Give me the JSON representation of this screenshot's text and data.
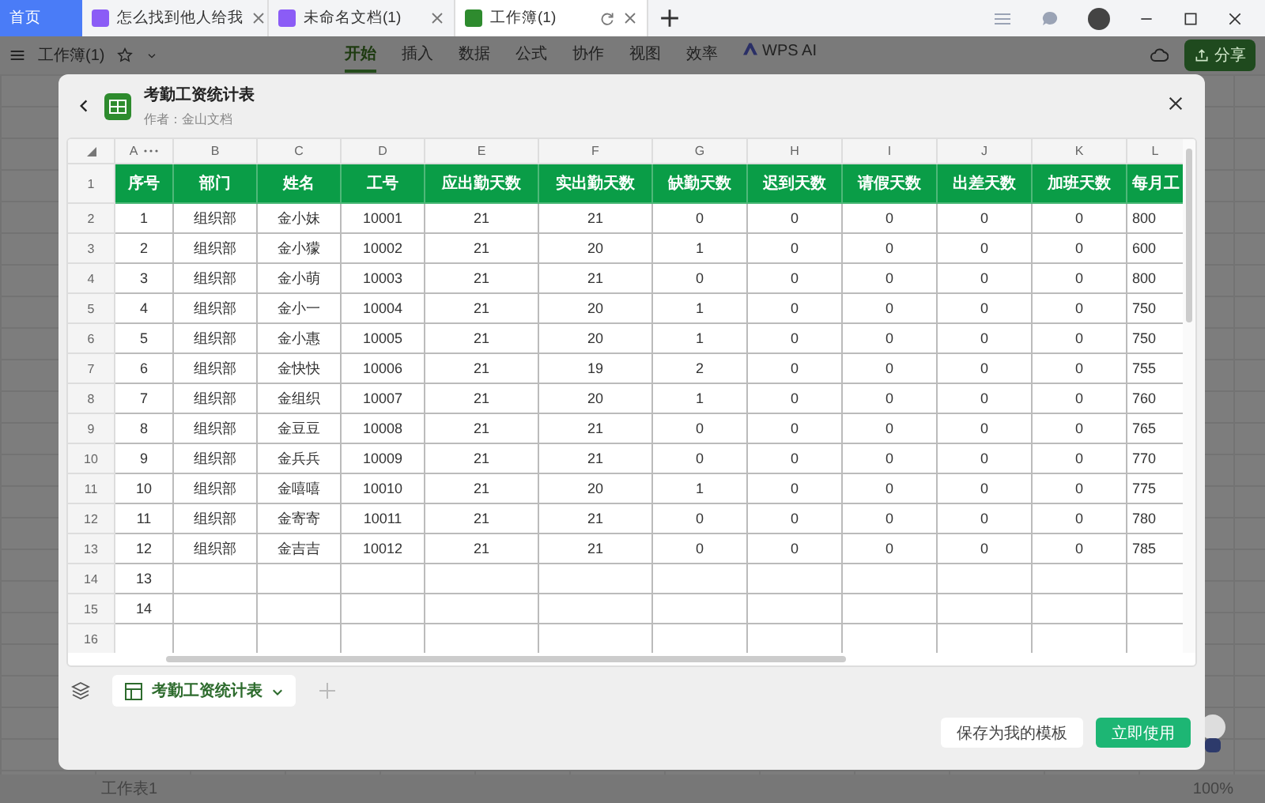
{
  "tabs": [
    {
      "label": "首页",
      "kind": "home",
      "selected": false
    },
    {
      "label": "怎么找到他人给我",
      "kind": "doc",
      "selected": false
    },
    {
      "label": "未命名文档(1)",
      "kind": "doc",
      "selected": false
    },
    {
      "label": "工作簿(1)",
      "kind": "sheet",
      "selected": true
    }
  ],
  "toolbar": {
    "doc_title": "工作簿(1)",
    "menu": [
      {
        "label": "开始",
        "selected": true
      },
      {
        "label": "插入",
        "selected": false
      },
      {
        "label": "数据",
        "selected": false
      },
      {
        "label": "公式",
        "selected": false
      },
      {
        "label": "协作",
        "selected": false
      },
      {
        "label": "视图",
        "selected": false
      },
      {
        "label": "效率",
        "selected": false
      },
      {
        "label": "WPS AI",
        "selected": false,
        "kind": "ai"
      }
    ],
    "share": "分享"
  },
  "dialog": {
    "title": "考勤工资统计表",
    "author": "作者：金山文档",
    "sheet": {
      "column_letters": [
        "A",
        "B",
        "C",
        "D",
        "E",
        "F",
        "G",
        "H",
        "I",
        "J",
        "K",
        "L"
      ],
      "row_numbers": [
        "1",
        "2",
        "3",
        "4",
        "5",
        "6",
        "7",
        "8",
        "9",
        "10",
        "11",
        "12",
        "13",
        "14",
        "15",
        "16"
      ],
      "header": [
        "序号",
        "部门",
        "姓名",
        "工号",
        "应出勤天数",
        "实出勤天数",
        "缺勤天数",
        "迟到天数",
        "请假天数",
        "出差天数",
        "加班天数",
        "每月工"
      ],
      "rows": [
        [
          "1",
          "组织部",
          "金小妹",
          "10001",
          "21",
          "21",
          "0",
          "0",
          "0",
          "0",
          "0",
          "800"
        ],
        [
          "2",
          "组织部",
          "金小獴",
          "10002",
          "21",
          "20",
          "1",
          "0",
          "0",
          "0",
          "0",
          "600"
        ],
        [
          "3",
          "组织部",
          "金小萌",
          "10003",
          "21",
          "21",
          "0",
          "0",
          "0",
          "0",
          "0",
          "800"
        ],
        [
          "4",
          "组织部",
          "金小一",
          "10004",
          "21",
          "20",
          "1",
          "0",
          "0",
          "0",
          "0",
          "750"
        ],
        [
          "5",
          "组织部",
          "金小惠",
          "10005",
          "21",
          "20",
          "1",
          "0",
          "0",
          "0",
          "0",
          "750"
        ],
        [
          "6",
          "组织部",
          "金快快",
          "10006",
          "21",
          "19",
          "2",
          "0",
          "0",
          "0",
          "0",
          "755"
        ],
        [
          "7",
          "组织部",
          "金组织",
          "10007",
          "21",
          "20",
          "1",
          "0",
          "0",
          "0",
          "0",
          "760"
        ],
        [
          "8",
          "组织部",
          "金豆豆",
          "10008",
          "21",
          "21",
          "0",
          "0",
          "0",
          "0",
          "0",
          "765"
        ],
        [
          "9",
          "组织部",
          "金兵兵",
          "10009",
          "21",
          "21",
          "0",
          "0",
          "0",
          "0",
          "0",
          "770"
        ],
        [
          "10",
          "组织部",
          "金嘻嘻",
          "10010",
          "21",
          "20",
          "1",
          "0",
          "0",
          "0",
          "0",
          "775"
        ],
        [
          "11",
          "组织部",
          "金寄寄",
          "10011",
          "21",
          "21",
          "0",
          "0",
          "0",
          "0",
          "0",
          "780"
        ],
        [
          "12",
          "组织部",
          "金吉吉",
          "10012",
          "21",
          "21",
          "0",
          "0",
          "0",
          "0",
          "0",
          "785"
        ],
        [
          "13"
        ],
        [
          "14"
        ]
      ]
    },
    "sheet_tab": "考勤工资统计表",
    "buttons": [
      {
        "label": "保存为我的模板",
        "kind": "secondary"
      },
      {
        "label": "立即使用",
        "kind": "primary"
      }
    ]
  },
  "status_bar": {
    "sheet_tab": "工作表1",
    "zoom": "100%"
  }
}
